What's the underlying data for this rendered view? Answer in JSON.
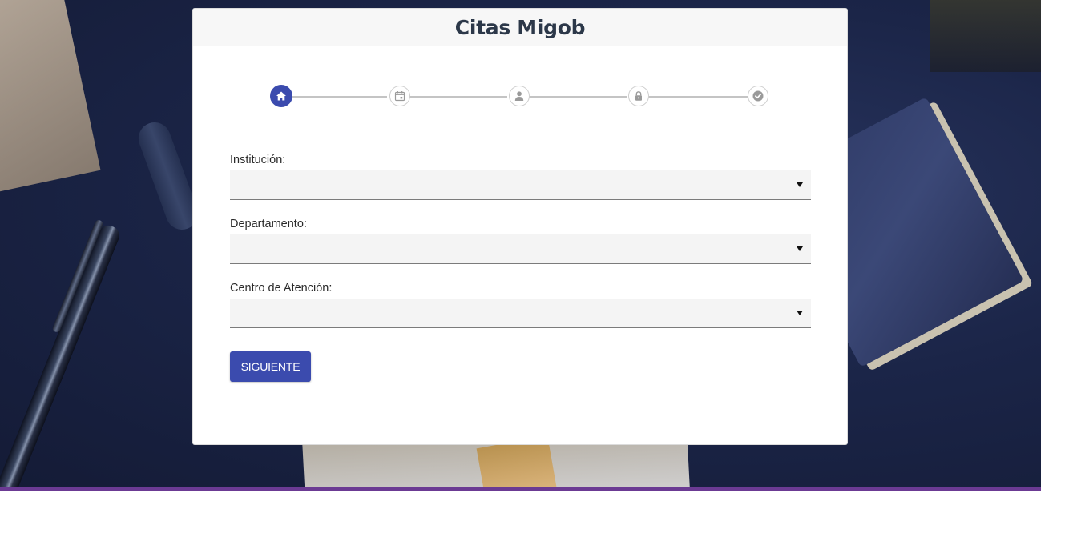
{
  "app": {
    "title": "Citas Migob"
  },
  "stepper": {
    "steps": [
      {
        "icon": "home-icon",
        "active": true
      },
      {
        "icon": "calendar-icon",
        "active": false
      },
      {
        "icon": "user-icon",
        "active": false
      },
      {
        "icon": "lock-icon",
        "active": false
      },
      {
        "icon": "check-circle-icon",
        "active": false
      }
    ],
    "colors": {
      "active": "#3b4bae",
      "inactive_icon": "#9a9a9a",
      "line": "#c4c4c4"
    }
  },
  "form": {
    "fields": [
      {
        "label": "Institución:",
        "value": ""
      },
      {
        "label": "Departamento:",
        "value": ""
      },
      {
        "label": "Centro de Atención:",
        "value": ""
      }
    ],
    "next_label": "SIGUIENTE"
  },
  "colors": {
    "accent": "#3b4bae",
    "title": "#2c3849",
    "hero_bar": "#6b3a93"
  }
}
